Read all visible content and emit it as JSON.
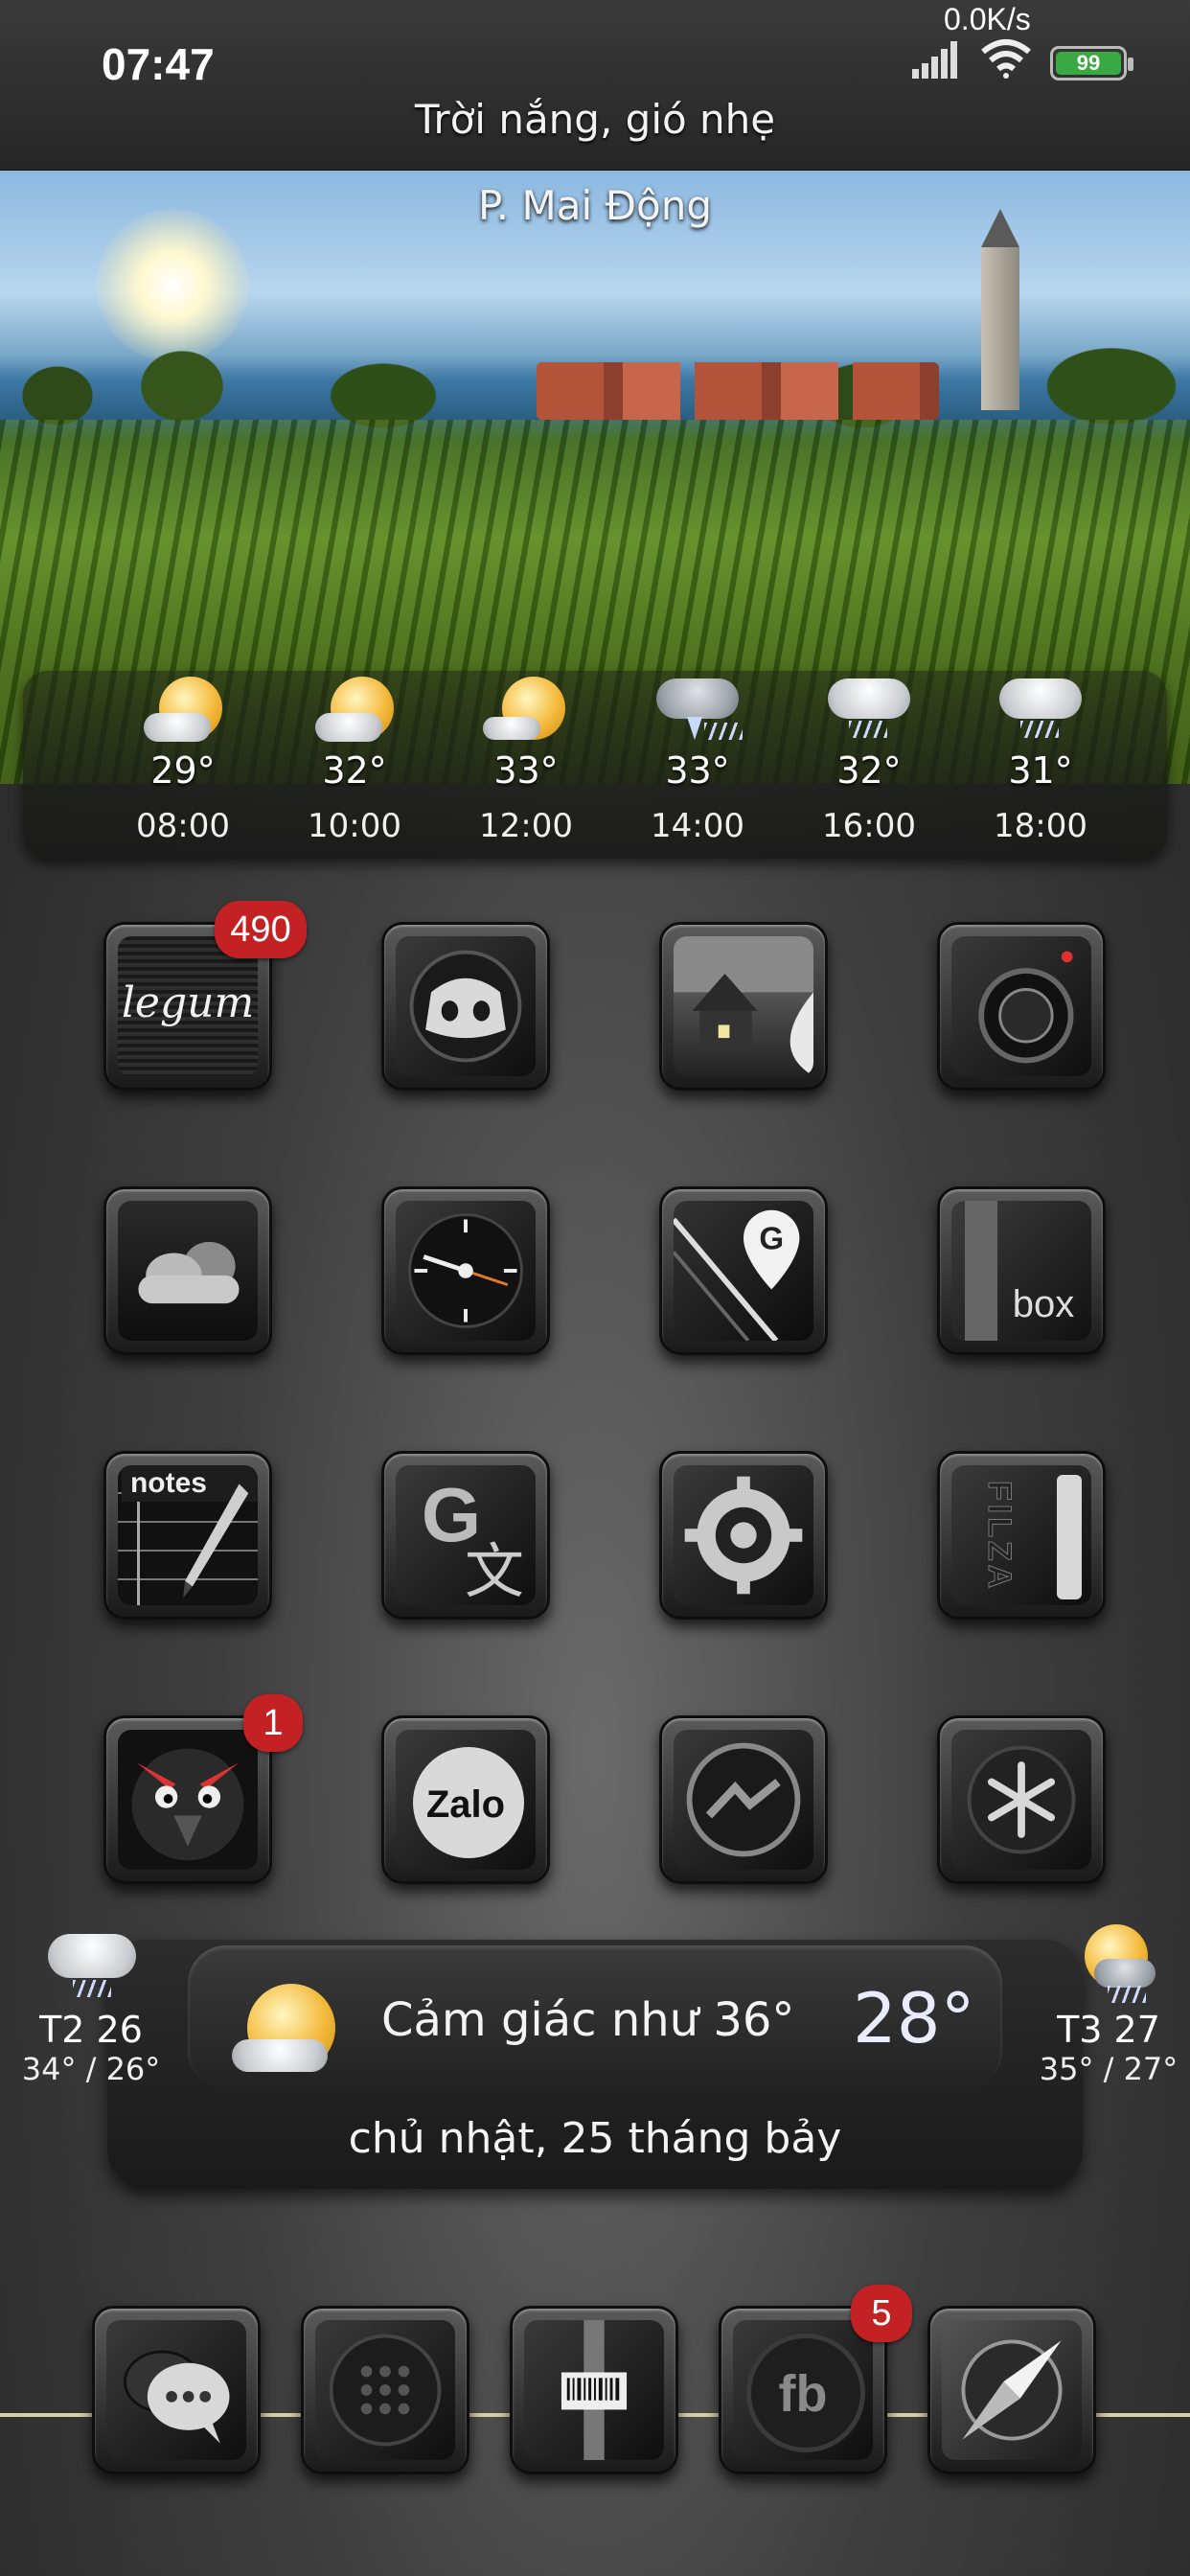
{
  "status_bar": {
    "time": "07:47",
    "net_speed": "0.0K/s",
    "battery_level": "99",
    "battery_color": "#3aa843"
  },
  "header": {
    "condition": "Trời nắng, gió nhẹ",
    "location": "P. Mai Động"
  },
  "hourly": [
    {
      "icon": "sun-cloud-icon",
      "temp": "29°",
      "time": "08:00"
    },
    {
      "icon": "sun-cloud-icon",
      "temp": "32°",
      "time": "10:00"
    },
    {
      "icon": "sun-cloud-icon",
      "temp": "33°",
      "time": "12:00"
    },
    {
      "icon": "thunderstorm-icon",
      "temp": "33°",
      "time": "14:00"
    },
    {
      "icon": "rain-cloud-icon",
      "temp": "32°",
      "time": "16:00"
    },
    {
      "icon": "rain-cloud-icon",
      "temp": "31°",
      "time": "18:00"
    }
  ],
  "apps": {
    "legum": {
      "label": "legum",
      "badge": "490"
    },
    "notes": {
      "label": "notes"
    },
    "box": {
      "label": "box"
    },
    "filza": {
      "label": "FILZA"
    },
    "zalo": {
      "label": "Zalo"
    },
    "angry_bird": {
      "badge": "1"
    },
    "facebook": {
      "label": "fb",
      "badge": "5"
    }
  },
  "widget": {
    "left_day": {
      "day": "T2 26",
      "range": "34° / 26°"
    },
    "right_day": {
      "day": "T3 27",
      "range": "35° / 27°"
    },
    "feels_like": "Cảm giác như 36°",
    "current_temp": "28°",
    "date": "chủ nhật, 25 tháng bảy"
  },
  "colors": {
    "badge": "#c42124",
    "accent_line": "#d8cfa8"
  }
}
